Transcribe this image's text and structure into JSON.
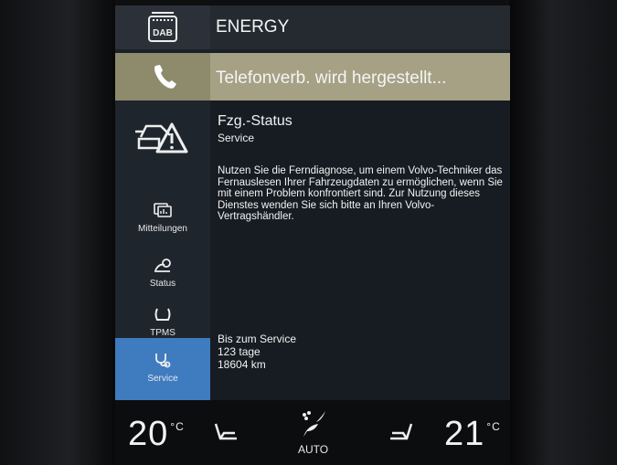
{
  "radio": {
    "icon": "radio-dab-icon",
    "badge": "DAB",
    "station": "ENERGY"
  },
  "phone": {
    "icon": "phone-handset-icon",
    "status": "Telefonverb. wird hergestellt..."
  },
  "sidebar": {
    "main_icon": "car-warning-icon",
    "items": [
      {
        "label": "Mitteilungen",
        "icon": "messages-icon"
      },
      {
        "label": "Status",
        "icon": "status-wrench-icon"
      },
      {
        "label": "TPMS",
        "icon": "tire-icon"
      },
      {
        "label": "Service",
        "icon": "service-stethoscope-icon",
        "selected": true
      }
    ]
  },
  "content": {
    "title": "Fzg.-Status",
    "subtitle": "Service",
    "description": "Nutzen Sie die Ferndiagnose, um einem Volvo-Techniker das Fernauslesen Ihrer Fahrzeugdaten zu ermöglichen, wenn Sie mit einem Problem konfrontiert sind. Zur Nutzung dieses Dienstes wenden Sie sich bitte an Ihren Volvo-Vertragshändler.",
    "service_label": "Bis zum Service",
    "service_days": "123 tage",
    "service_km": "18604 km"
  },
  "climate": {
    "left_temp": "20",
    "right_temp": "21",
    "unit": "°C",
    "mode": "AUTO",
    "left_seat_icon": "seat-heat-left-icon",
    "right_seat_icon": "seat-heat-right-icon",
    "fan_icon": "fan-auto-icon"
  },
  "colors": {
    "selected": "#3f7bbf",
    "phone_bar": "#a6a185"
  }
}
